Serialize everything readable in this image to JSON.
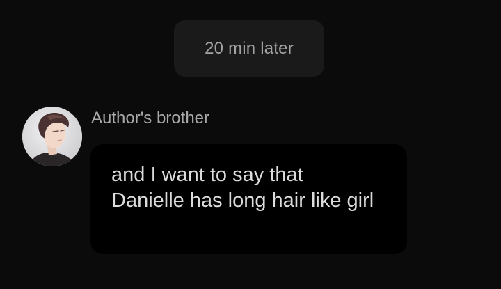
{
  "timestamp_chip": {
    "label": "20 min later"
  },
  "message": {
    "sender_name": "Author's brother",
    "avatar_icon": "avatar-portrait-icon",
    "text": "and I want to say that Danielle has long hair like girl"
  },
  "colors": {
    "background": "#0b0b0b",
    "chip_background": "#1a1a1a",
    "bubble_background": "#000000",
    "text_primary": "#dcdcdc",
    "text_secondary": "#a9a9a9"
  }
}
